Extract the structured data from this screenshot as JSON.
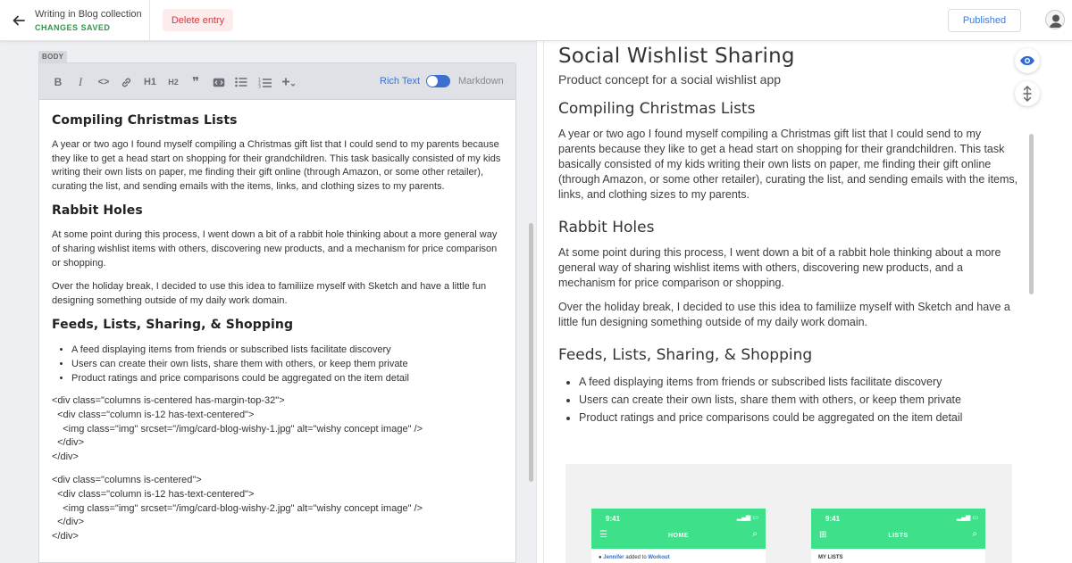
{
  "header": {
    "collection_title": "Writing in Blog collection",
    "save_status": "CHANGES SAVED",
    "delete_label": "Delete entry",
    "published_label": "Published"
  },
  "editor": {
    "field_label": "BODY",
    "toolbar": {
      "bold": "B",
      "italic": "I",
      "code": "<>",
      "h1": "H1",
      "h2": "H2",
      "quote": "❞",
      "rich_text_label": "Rich Text",
      "markdown_label": "Markdown",
      "mode": "rich-text"
    },
    "content": {
      "h_compiling": "Compiling Christmas Lists",
      "p1": "A year or two ago I found myself compiling a Christmas gift list that I could send to my parents because they like to get a head start on shopping for their grandchildren. This task basically consisted of my kids writing their own lists on paper, me finding their gift online (through Amazon, or some other retailer), curating the list, and sending emails with the items, links, and clothing sizes to my parents.",
      "h_rabbit": "Rabbit Holes",
      "p2": "At some point during this process, I went down a bit of a rabbit hole  thinking about a more general way of sharing wishlist items with others, discovering new products, and a mechanism for price comparison or shopping.",
      "p3": "Over the holiday break, I decided to use this idea to familiize myself with Sketch and have a little fun designing something outside of my daily work domain.",
      "h_feeds": "Feeds, Lists, Sharing, & Shopping",
      "li1": "A feed displaying items from friends or subscribed lists facilitate discovery",
      "li2": "Users can create their own lists, share them with others, or keep them private",
      "li3": "Product ratings and price comparisons could be aggregated on the item detail",
      "code1": "<div class=\"columns is-centered has-margin-top-32\">\n  <div class=\"column is-12 has-text-centered\">\n    <img class=\"img\" srcset=\"/img/card-blog-wishy-1.jpg\" alt=\"wishy concept image\" />\n  </div>\n</div>",
      "code2": "<div class=\"columns is-centered\">\n  <div class=\"column is-12 has-text-centered\">\n    <img class=\"img\" srcset=\"/img/card-blog-wishy-2.jpg\" alt=\"wishy concept image\" />\n  </div>\n</div>"
    }
  },
  "preview": {
    "title": "Social Wishlist Sharing",
    "subtitle": "Product concept for a social wishlist app",
    "h_compiling": "Compiling Christmas Lists",
    "p1": "A year or two ago I found myself compiling a Christmas gift list that I could send to my parents because they like to get a head start on shopping for their grandchildren. This task basically consisted of my kids writing their own lists on paper, me finding their gift online (through Amazon, or some other retailer), curating the list, and sending emails with the items, links, and clothing sizes to my parents.",
    "h_rabbit": "Rabbit Holes",
    "p2": "At some point during this process, I went down a bit of a rabbit hole thinking about a more general way of sharing wishlist items with others, discovering new products, and a mechanism for price comparison or shopping.",
    "p3": "Over the holiday break, I decided to use this idea to familiize myself with Sketch and have a little fun designing something outside of my daily work domain.",
    "h_feeds": "Feeds, Lists, Sharing, & Shopping",
    "li1": "A feed displaying items from friends or subscribed lists facilitate discovery",
    "li2": "Users can create their own lists, share them with others, or keep them private",
    "li3": "Product ratings and price comparisons could be aggregated on the item detail",
    "image": {
      "phone1": {
        "time": "9:41",
        "nav_title": "HOME",
        "row_user": "Jennifer",
        "row_text": "added to",
        "row_target": "Workout"
      },
      "phone2": {
        "time": "9:41",
        "nav_title": "LISTS",
        "row_text": "MY LISTS"
      }
    }
  },
  "colors": {
    "accent_blue": "#3b6fd0",
    "saved_green": "#2a9a46",
    "delete_red": "#d9363e",
    "app_green": "#3fe08a"
  }
}
